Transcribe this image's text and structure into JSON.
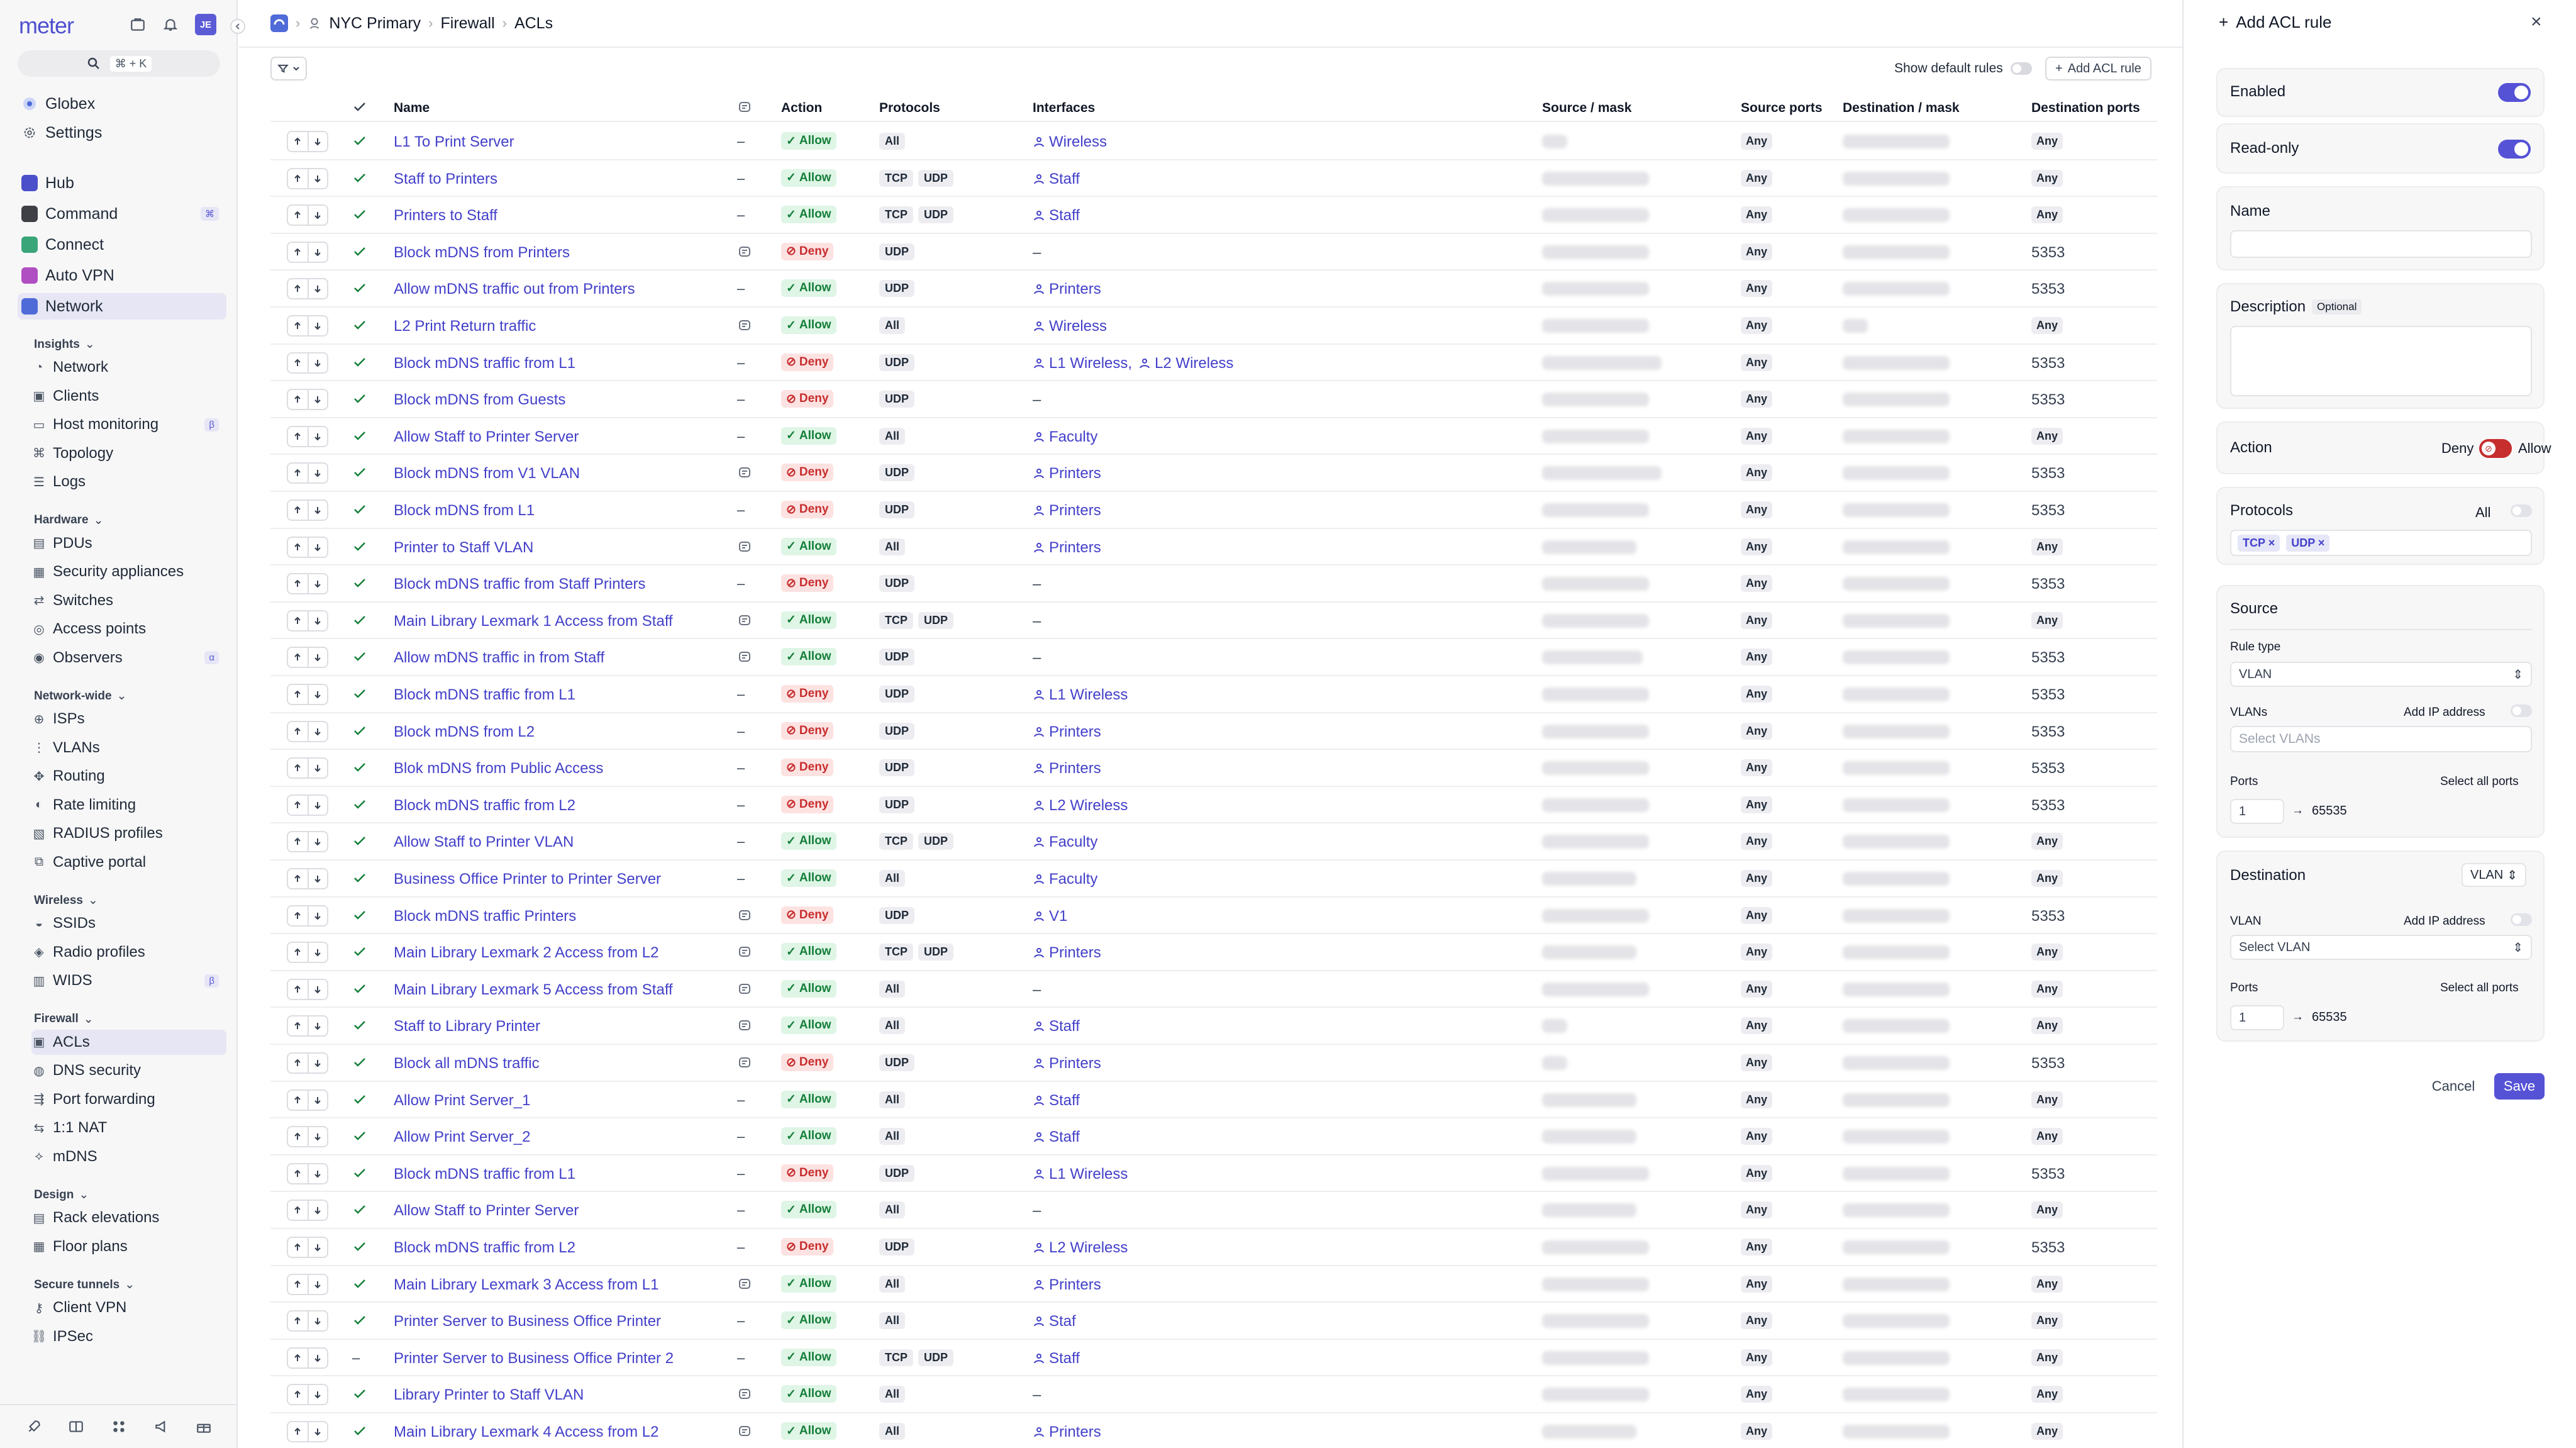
{
  "app": {
    "logo": "meter",
    "avatar": "JE",
    "search_shortcut": "⌘ + K"
  },
  "sidebar": {
    "org": "Globex",
    "settings": "Settings",
    "top": [
      {
        "label": "Hub",
        "color": "#4b4fc9"
      },
      {
        "label": "Command",
        "color": "#3f3f46",
        "badge": "⌘"
      },
      {
        "label": "Connect",
        "color": "#3ba57a"
      },
      {
        "label": "Auto VPN",
        "color": "#b04fc2"
      },
      {
        "label": "Network",
        "color": "#4f6bd8"
      }
    ],
    "sections": [
      {
        "title": "Insights",
        "items": [
          {
            "label": "Network",
            "icon": "network-icon"
          },
          {
            "label": "Clients",
            "icon": "clients-icon"
          },
          {
            "label": "Host monitoring",
            "icon": "monitor-icon",
            "badge": "β"
          },
          {
            "label": "Topology",
            "icon": "topology-icon"
          },
          {
            "label": "Logs",
            "icon": "logs-icon"
          }
        ]
      },
      {
        "title": "Hardware",
        "items": [
          {
            "label": "PDUs",
            "icon": "pdu-icon"
          },
          {
            "label": "Security appliances",
            "icon": "appliance-icon"
          },
          {
            "label": "Switches",
            "icon": "switch-icon"
          },
          {
            "label": "Access points",
            "icon": "ap-icon"
          },
          {
            "label": "Observers",
            "icon": "observer-icon",
            "badge": "α"
          }
        ]
      },
      {
        "title": "Network-wide",
        "items": [
          {
            "label": "ISPs",
            "icon": "globe-icon"
          },
          {
            "label": "VLANs",
            "icon": "vlan-icon"
          },
          {
            "label": "Routing",
            "icon": "routing-icon"
          },
          {
            "label": "Rate limiting",
            "icon": "gauge-icon"
          },
          {
            "label": "RADIUS profiles",
            "icon": "radius-icon"
          },
          {
            "label": "Captive portal",
            "icon": "portal-icon"
          }
        ]
      },
      {
        "title": "Wireless",
        "items": [
          {
            "label": "SSIDs",
            "icon": "ssid-icon"
          },
          {
            "label": "Radio profiles",
            "icon": "radio-icon"
          },
          {
            "label": "WIDS",
            "icon": "wids-icon",
            "badge": "β"
          }
        ]
      },
      {
        "title": "Firewall",
        "items": [
          {
            "label": "ACLs",
            "icon": "acl-icon",
            "active": true
          },
          {
            "label": "DNS security",
            "icon": "dns-icon"
          },
          {
            "label": "Port forwarding",
            "icon": "port-icon"
          },
          {
            "label": "1:1 NAT",
            "icon": "nat-icon"
          },
          {
            "label": "mDNS",
            "icon": "mdns-icon"
          }
        ]
      },
      {
        "title": "Design",
        "items": [
          {
            "label": "Rack elevations",
            "icon": "rack-icon"
          },
          {
            "label": "Floor plans",
            "icon": "floor-icon"
          }
        ]
      },
      {
        "title": "Secure tunnels",
        "items": [
          {
            "label": "Client VPN",
            "icon": "vpn-icon"
          },
          {
            "label": "IPSec",
            "icon": "ipsec-icon"
          }
        ]
      }
    ]
  },
  "breadcrumb": {
    "network": "NYC Primary",
    "section": "Firewall",
    "page": "ACLs"
  },
  "toolbar": {
    "show_default": "Show default rules",
    "add": "Add ACL rule"
  },
  "table": {
    "headers": {
      "name": "Name",
      "action": "Action",
      "protocols": "Protocols",
      "interfaces": "Interfaces",
      "source": "Source / mask",
      "sport": "Source ports",
      "dest": "Destination / mask",
      "dport": "Destination ports"
    },
    "rows": [
      {
        "name": "L1 To Print Server",
        "desc": false,
        "action": "Allow",
        "protocols": [
          "All"
        ],
        "interfaces": [
          "Wireless"
        ],
        "sport": "Any",
        "dport": "Any"
      },
      {
        "name": "Staff to Printers",
        "desc": false,
        "action": "Allow",
        "protocols": [
          "TCP",
          "UDP"
        ],
        "interfaces": [
          "Staff"
        ],
        "sport": "Any",
        "dport": "Any"
      },
      {
        "name": "Printers to Staff",
        "desc": false,
        "action": "Allow",
        "protocols": [
          "TCP",
          "UDP"
        ],
        "interfaces": [
          "Staff"
        ],
        "sport": "Any",
        "dport": "Any"
      },
      {
        "name": "Block mDNS from Printers",
        "desc": true,
        "action": "Deny",
        "protocols": [
          "UDP"
        ],
        "interfaces": [],
        "sport": "Any",
        "dport": "5353"
      },
      {
        "name": "Allow mDNS traffic out from Printers",
        "desc": false,
        "action": "Allow",
        "protocols": [
          "UDP"
        ],
        "interfaces": [
          "Printers"
        ],
        "sport": "Any",
        "dport": "5353"
      },
      {
        "name": "L2 Print Return traffic",
        "desc": true,
        "action": "Allow",
        "protocols": [
          "All"
        ],
        "interfaces": [
          "Wireless"
        ],
        "sport": "Any",
        "dport": "Any"
      },
      {
        "name": "Block mDNS traffic from L1",
        "desc": false,
        "action": "Deny",
        "protocols": [
          "UDP"
        ],
        "interfaces": [
          "L1 Wireless,",
          "L2 Wireless"
        ],
        "sport": "Any",
        "dport": "5353"
      },
      {
        "name": "Block mDNS from Guests",
        "desc": false,
        "action": "Deny",
        "protocols": [
          "UDP"
        ],
        "interfaces": [],
        "sport": "Any",
        "dport": "5353"
      },
      {
        "name": "Allow Staff to Printer Server",
        "desc": false,
        "action": "Allow",
        "protocols": [
          "All"
        ],
        "interfaces": [
          "Faculty"
        ],
        "sport": "Any",
        "dport": "Any"
      },
      {
        "name": "Block mDNS from V1 VLAN",
        "desc": true,
        "action": "Deny",
        "protocols": [
          "UDP"
        ],
        "interfaces": [
          "Printers"
        ],
        "sport": "Any",
        "dport": "5353"
      },
      {
        "name": "Block mDNS from L1",
        "desc": false,
        "action": "Deny",
        "protocols": [
          "UDP"
        ],
        "interfaces": [
          "Printers"
        ],
        "sport": "Any",
        "dport": "5353"
      },
      {
        "name": "Printer to Staff VLAN",
        "desc": true,
        "action": "Allow",
        "protocols": [
          "All"
        ],
        "interfaces": [
          "Printers"
        ],
        "sport": "Any",
        "dport": "Any"
      },
      {
        "name": "Block mDNS traffic from Staff Printers",
        "desc": false,
        "action": "Deny",
        "protocols": [
          "UDP"
        ],
        "interfaces": [],
        "sport": "Any",
        "dport": "5353"
      },
      {
        "name": "Main Library Lexmark 1 Access from Staff",
        "desc": true,
        "action": "Allow",
        "protocols": [
          "TCP",
          "UDP"
        ],
        "interfaces": [],
        "sport": "Any",
        "dport": "Any"
      },
      {
        "name": "Allow mDNS traffic in from Staff",
        "desc": true,
        "action": "Allow",
        "protocols": [
          "UDP"
        ],
        "interfaces": [],
        "sport": "Any",
        "dport": "5353"
      },
      {
        "name": "Block mDNS traffic from L1",
        "desc": false,
        "action": "Deny",
        "protocols": [
          "UDP"
        ],
        "interfaces": [
          "L1 Wireless"
        ],
        "sport": "Any",
        "dport": "5353"
      },
      {
        "name": "Block mDNS from L2",
        "desc": false,
        "action": "Deny",
        "protocols": [
          "UDP"
        ],
        "interfaces": [
          "Printers"
        ],
        "sport": "Any",
        "dport": "5353"
      },
      {
        "name": "Blok mDNS from Public Access",
        "desc": false,
        "action": "Deny",
        "protocols": [
          "UDP"
        ],
        "interfaces": [
          "Printers"
        ],
        "sport": "Any",
        "dport": "5353"
      },
      {
        "name": "Block mDNS traffic from L2",
        "desc": false,
        "action": "Deny",
        "protocols": [
          "UDP"
        ],
        "interfaces": [
          "L2 Wireless"
        ],
        "sport": "Any",
        "dport": "5353"
      },
      {
        "name": "Allow Staff to Printer VLAN",
        "desc": false,
        "action": "Allow",
        "protocols": [
          "TCP",
          "UDP"
        ],
        "interfaces": [
          "Faculty"
        ],
        "sport": "Any",
        "dport": "Any"
      },
      {
        "name": "Business Office Printer to Printer Server",
        "desc": false,
        "action": "Allow",
        "protocols": [
          "All"
        ],
        "interfaces": [
          "Faculty"
        ],
        "sport": "Any",
        "dport": "Any"
      },
      {
        "name": "Block mDNS traffic Printers",
        "desc": true,
        "action": "Deny",
        "protocols": [
          "UDP"
        ],
        "interfaces": [
          "V1"
        ],
        "sport": "Any",
        "dport": "5353"
      },
      {
        "name": "Main Library Lexmark 2 Access from L2",
        "desc": true,
        "action": "Allow",
        "protocols": [
          "TCP",
          "UDP"
        ],
        "interfaces": [
          "Printers"
        ],
        "sport": "Any",
        "dport": "Any"
      },
      {
        "name": "Main Library Lexmark 5 Access from Staff",
        "desc": true,
        "action": "Allow",
        "protocols": [
          "All"
        ],
        "interfaces": [],
        "sport": "Any",
        "dport": "Any"
      },
      {
        "name": "Staff to Library Printer",
        "desc": true,
        "action": "Allow",
        "protocols": [
          "All"
        ],
        "interfaces": [
          "Staff"
        ],
        "sport": "Any",
        "dport": "Any"
      },
      {
        "name": "Block all mDNS traffic",
        "desc": true,
        "action": "Deny",
        "protocols": [
          "UDP"
        ],
        "interfaces": [
          "Printers"
        ],
        "sport": "Any",
        "dport": "5353"
      },
      {
        "name": "Allow Print Server_1",
        "desc": false,
        "action": "Allow",
        "protocols": [
          "All"
        ],
        "interfaces": [
          "Staff"
        ],
        "sport": "Any",
        "dport": "Any"
      },
      {
        "name": "Allow Print Server_2",
        "desc": false,
        "action": "Allow",
        "protocols": [
          "All"
        ],
        "interfaces": [
          "Staff"
        ],
        "sport": "Any",
        "dport": "Any"
      },
      {
        "name": "Block mDNS traffic from L1",
        "desc": false,
        "action": "Deny",
        "protocols": [
          "UDP"
        ],
        "interfaces": [
          "L1 Wireless"
        ],
        "sport": "Any",
        "dport": "5353"
      },
      {
        "name": "Allow Staff to Printer Server",
        "desc": false,
        "action": "Allow",
        "protocols": [
          "All"
        ],
        "interfaces": [],
        "sport": "Any",
        "dport": "Any"
      },
      {
        "name": "Block mDNS traffic from L2",
        "desc": false,
        "action": "Deny",
        "protocols": [
          "UDP"
        ],
        "interfaces": [
          "L2 Wireless"
        ],
        "sport": "Any",
        "dport": "5353"
      },
      {
        "name": "Main Library Lexmark 3 Access from L1",
        "desc": true,
        "action": "Allow",
        "protocols": [
          "All"
        ],
        "interfaces": [
          "Printers"
        ],
        "sport": "Any",
        "dport": "Any"
      },
      {
        "name": "Printer Server to Business Office Printer",
        "desc": false,
        "action": "Allow",
        "protocols": [
          "All"
        ],
        "interfaces": [
          "Staf"
        ],
        "sport": "Any",
        "dport": "Any"
      },
      {
        "name": "Printer Server to Business Office Printer 2",
        "desc": false,
        "action": "Allow",
        "protocols": [
          "TCP",
          "UDP"
        ],
        "interfaces": [
          "Staff"
        ],
        "sport": "Any",
        "dport": "Any",
        "disabled": true
      },
      {
        "name": "Library Printer to Staff VLAN",
        "desc": true,
        "action": "Allow",
        "protocols": [
          "All"
        ],
        "interfaces": [],
        "sport": "Any",
        "dport": "Any"
      },
      {
        "name": "Main Library Lexmark 4 Access from L2",
        "desc": true,
        "action": "Allow",
        "protocols": [
          "All"
        ],
        "interfaces": [
          "Printers"
        ],
        "sport": "Any",
        "dport": "Any"
      }
    ]
  },
  "panel": {
    "title": "Add ACL rule",
    "enabled": "Enabled",
    "read_only": "Read-only",
    "name": "Name",
    "description": "Description",
    "optional": "Optional",
    "action": "Action",
    "deny": "Deny",
    "allow": "Allow",
    "protocols": "Protocols",
    "all": "All",
    "chips": [
      "TCP",
      "UDP"
    ],
    "source": "Source",
    "rule_type": "Rule type",
    "rule_type_value": "VLAN",
    "vlans": "VLANs",
    "add_ip": "Add IP address",
    "select_vlans": "Select VLANs",
    "ports": "Ports",
    "select_all_ports": "Select all ports",
    "port_from": "1",
    "port_to": "65535",
    "destination": "Destination",
    "dest_type": "VLAN",
    "vlan": "VLAN",
    "select_vlan": "Select VLAN",
    "cancel": "Cancel",
    "save": "Save"
  },
  "colors": {
    "accent": "#5552d6",
    "link": "#4340c9",
    "allow_bg": "#dff5e6",
    "deny_bg": "#fde2e2"
  }
}
